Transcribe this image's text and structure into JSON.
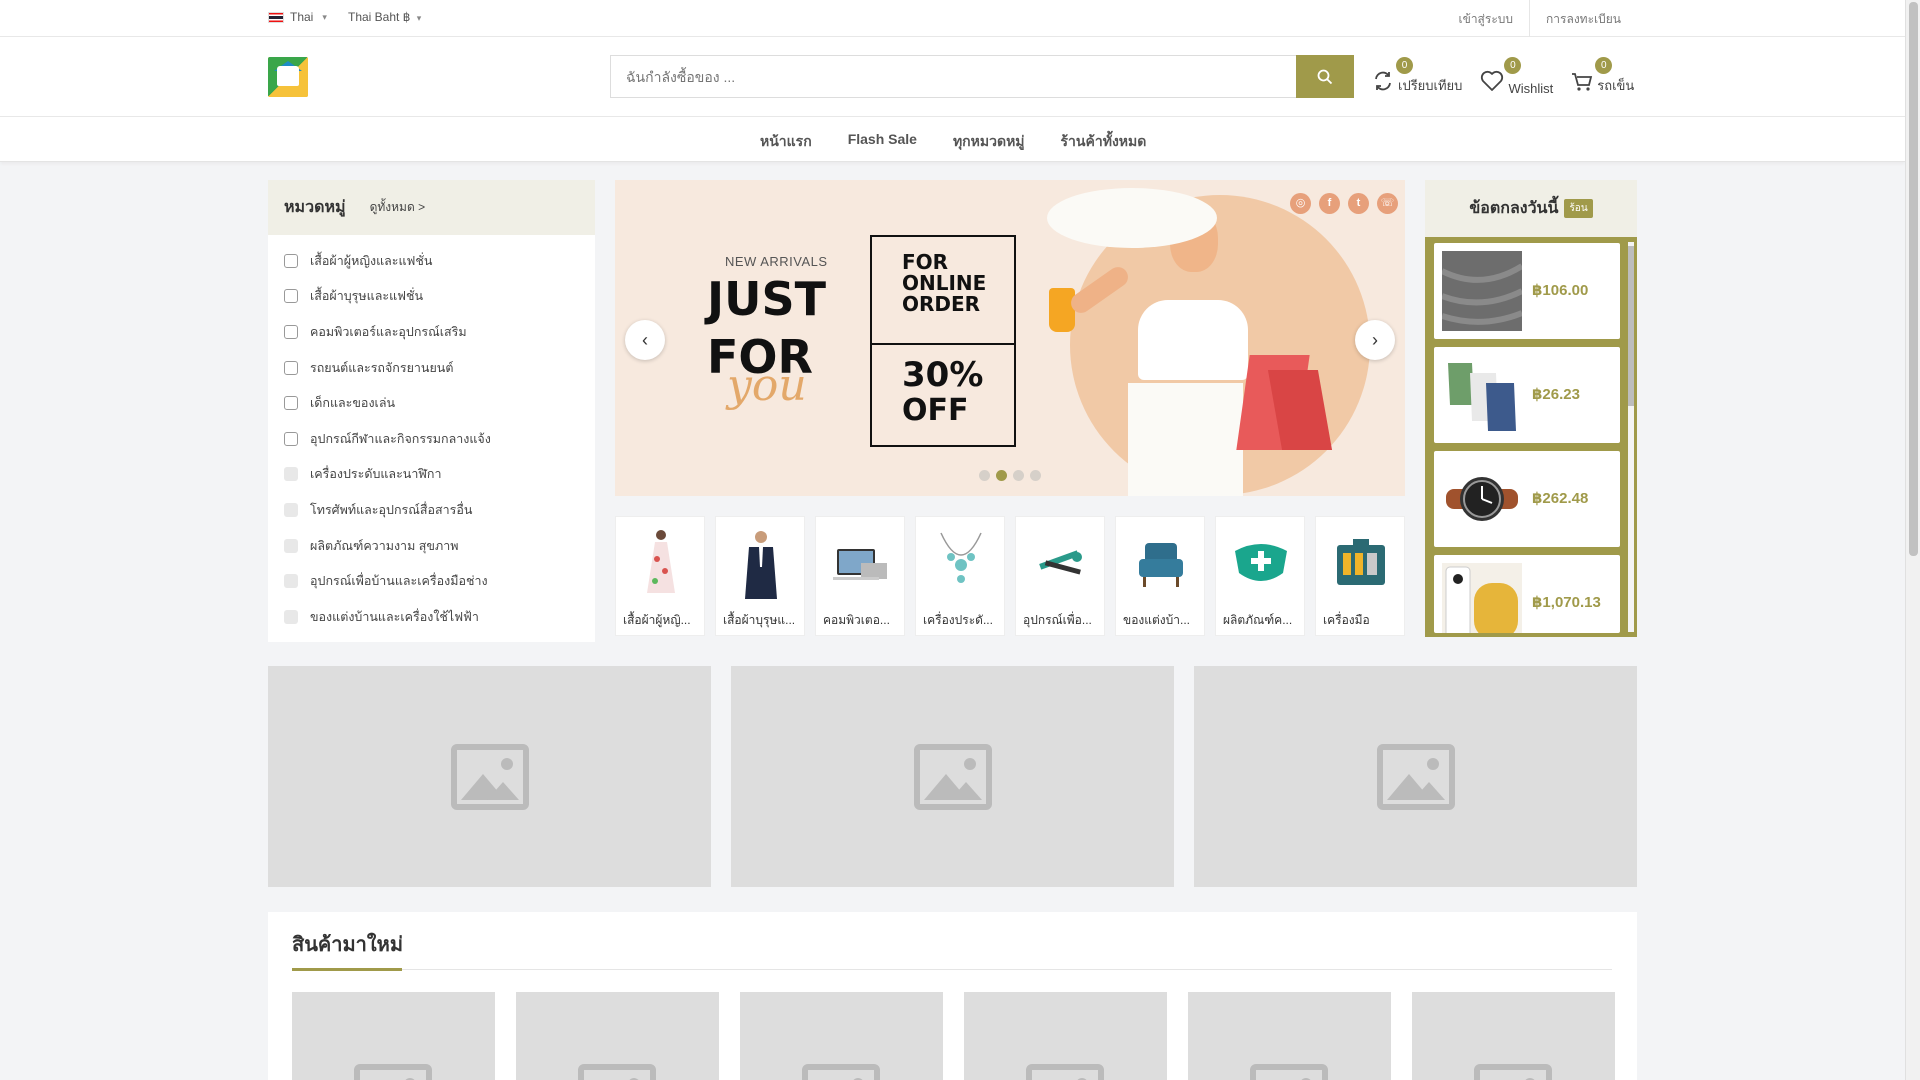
{
  "topbar": {
    "language": "Thai",
    "currency": "Thai Baht ฿",
    "login": "เข้าสู่ระบบ",
    "register": "การลงทะเบียน"
  },
  "search": {
    "placeholder": "ฉันกำลังซื้อของ ..."
  },
  "header_icons": [
    {
      "name": "compare",
      "label": "เปรียบเทียบ",
      "count": "0"
    },
    {
      "name": "wishlist",
      "label": "Wishlist",
      "count": "0"
    },
    {
      "name": "cart",
      "label": "รถเข็น",
      "count": "0"
    }
  ],
  "nav": [
    "หน้าแรก",
    "Flash Sale",
    "ทุกหมวดหมู่",
    "ร้านค้าทั้งหมด"
  ],
  "categories": {
    "title": "หมวดหมู่",
    "view_all": "ดูทั้งหมด >",
    "items": [
      "เสื้อผ้าผู้หญิงและแฟชั่น",
      "เสื้อผ้าบุรุษและแฟชั่น",
      "คอมพิวเตอร์และอุปกรณ์เสริม",
      "รถยนต์และรถจักรยานยนต์",
      "เด็กและของเล่น",
      "อุปกรณ์กีฬาและกิจกรรมกลางแจ้ง",
      "เครื่องประดับและนาฬิกา",
      "โทรศัพท์และอุปกรณ์สื่อสารอื่น",
      "ผลิตภัณฑ์ความงาม สุขภาพ",
      "อุปกรณ์เพื่อบ้านและเครื่องมือช่าง",
      "ของแต่งบ้านและเครื่องใช้ไฟฟ้า"
    ]
  },
  "banner": {
    "line1": "NEW ARRIVALS",
    "line2": "JUST",
    "line3": "FOR",
    "line4": "you",
    "box1": [
      "FOR",
      "ONLINE",
      "ORDER"
    ],
    "box2_pct": "30%",
    "box2_off": "OFF",
    "social": [
      "instagram-icon",
      "facebook-icon",
      "twitter-icon",
      "whatsapp-icon"
    ],
    "slides": 4,
    "active_slide": 2
  },
  "thumb_categories": [
    "เสื้อผ้าผู้หญิ...",
    "เสื้อผ้าบุรุษแ...",
    "คอมพิวเตอ...",
    "เครื่องประดั...",
    "อุปกรณ์เพื่อ...",
    "ของแต่งบ้า...",
    "ผลิตภัณฑ์ค...",
    "เครื่องมือ"
  ],
  "deals": {
    "title": "ข้อตกลงวันนี้",
    "badge": "ร้อน",
    "items": [
      {
        "price": "฿106.00"
      },
      {
        "price": "฿26.23"
      },
      {
        "price": "฿262.48"
      },
      {
        "price": "฿1,070.13"
      }
    ]
  },
  "new_products": {
    "title": "สินค้ามาใหม่"
  },
  "colors": {
    "accent": "#a09a4a",
    "header_bg": "#f0efe6"
  }
}
